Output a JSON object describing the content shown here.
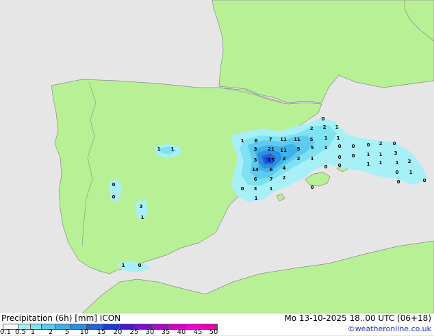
{
  "legend": {
    "title": "Precipitation (6h) [mm] ICON",
    "valid": "Mo 13-10-2025 18..00 UTC (06+18)",
    "credit": "©weatheronline.co.uk",
    "colors": [
      "#fdfdfd",
      "#a8f0f8",
      "#7ee2f2",
      "#5ccbee",
      "#3cb2e8",
      "#2b8fe0",
      "#2262d6",
      "#1e3ccf",
      "#4a18c8",
      "#7a10c8",
      "#a808c8",
      "#d400c8",
      "#f000d0",
      "#e600b0"
    ],
    "tick_labels": [
      "0.1",
      "0.5",
      "1",
      "2",
      "5",
      "10",
      "15",
      "20",
      "25",
      "30",
      "35",
      "40",
      "45",
      "50"
    ]
  },
  "map": {
    "land_color": "#b8f096",
    "sea_color": "#e6e6e6",
    "precip_values": [
      {
        "v": "0"
      },
      {
        "v": "2"
      },
      {
        "v": "2"
      },
      {
        "v": "1"
      },
      {
        "v": "1"
      },
      {
        "v": "6"
      },
      {
        "v": "7"
      },
      {
        "v": "11"
      },
      {
        "v": "11"
      },
      {
        "v": "5"
      },
      {
        "v": "1"
      },
      {
        "v": "1"
      },
      {
        "v": "3"
      },
      {
        "v": "21"
      },
      {
        "v": "11"
      },
      {
        "v": "5"
      },
      {
        "v": "5"
      },
      {
        "v": "1"
      },
      {
        "v": "0"
      },
      {
        "v": "0"
      },
      {
        "v": "0"
      },
      {
        "v": "2"
      },
      {
        "v": "0"
      },
      {
        "v": "3"
      },
      {
        "v": "15"
      },
      {
        "v": "2"
      },
      {
        "v": "2"
      },
      {
        "v": "1"
      },
      {
        "v": "0"
      },
      {
        "v": "0"
      },
      {
        "v": "1"
      },
      {
        "v": "1"
      },
      {
        "v": "3"
      },
      {
        "v": "14"
      },
      {
        "v": "6"
      },
      {
        "v": "4"
      },
      {
        "v": "0"
      },
      {
        "v": "0"
      },
      {
        "v": "1"
      },
      {
        "v": "1"
      },
      {
        "v": "6"
      },
      {
        "v": "7"
      },
      {
        "v": "2"
      },
      {
        "v": "1"
      },
      {
        "v": "2"
      },
      {
        "v": "1"
      },
      {
        "v": "0"
      },
      {
        "v": "3"
      },
      {
        "v": "1"
      },
      {
        "v": "0"
      },
      {
        "v": "0"
      },
      {
        "v": "0"
      },
      {
        "v": "1"
      },
      {
        "v": "1"
      },
      {
        "v": "1"
      },
      {
        "v": "1"
      },
      {
        "v": "0"
      },
      {
        "v": "0"
      },
      {
        "v": "3"
      },
      {
        "v": "1"
      },
      {
        "v": "0"
      },
      {
        "v": "0"
      }
    ]
  }
}
